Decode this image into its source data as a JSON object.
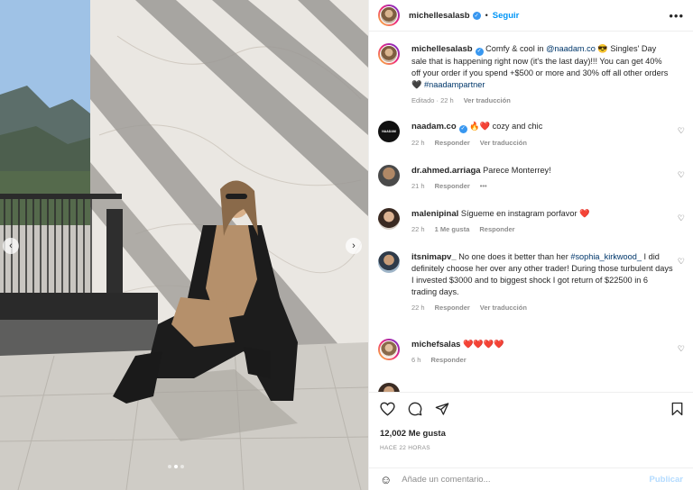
{
  "post": {
    "username": "michellesalasb",
    "separator": "•",
    "follow_label": "Seguir",
    "more_label": "•••"
  },
  "caption": {
    "username": "michellesalasb",
    "text_before_mention": "Comfy & cool in ",
    "mention": "@naadam.co",
    "text_after_mention": " 😎 Singles' Day sale that is happening right now (it's the last day)!!! You can get 40% off your order if you spend +$500 or more and 30% off all other orders 🖤 ",
    "hashtag": "#naadampartner",
    "edited": "Editado · 22 h",
    "translate": "Ver traducción"
  },
  "comments": [
    {
      "username": "naadam.co",
      "text": "🔥❤️ cozy and chic",
      "time": "22 h",
      "reply": "Responder",
      "translate": "Ver traducción"
    },
    {
      "username": "dr.ahmed.arriaga",
      "text": "Parece Monterrey!",
      "time": "21 h",
      "reply": "Responder",
      "more": "•••"
    },
    {
      "username": "malenipinal",
      "text": "Sígueme en instagram porfavor ❤️",
      "time": "22 h",
      "likes": "1 Me gusta",
      "reply": "Responder"
    },
    {
      "username": "itsnimapv_",
      "text_before_mention": "No one does it better than her ",
      "mention": "#sophia_kirkwood_",
      "text_after_mention": " I did definitely choose her over any other trader! During those turbulent days I invested $3000 and to biggest shock I got return of $22500 in 6 trading days.",
      "time": "22 h",
      "reply": "Responder",
      "translate": "Ver traducción"
    },
    {
      "username": "michefsalas",
      "text": "❤️❤️❤️❤️",
      "time": "6 h",
      "reply": "Responder"
    }
  ],
  "footer": {
    "likes": "12,002 Me gusta",
    "timestamp": "HACE 22 HORAS",
    "comment_placeholder": "Añade un comentario...",
    "publish_label": "Publicar"
  },
  "icons": {
    "heart": "♡",
    "arrow_left": "‹",
    "arrow_right": "›",
    "emoji": "☺"
  },
  "colors": {
    "accent": "#0095f6",
    "verified": "#3897f0",
    "link": "#00376b",
    "publish_disabled": "#b3dbff"
  }
}
